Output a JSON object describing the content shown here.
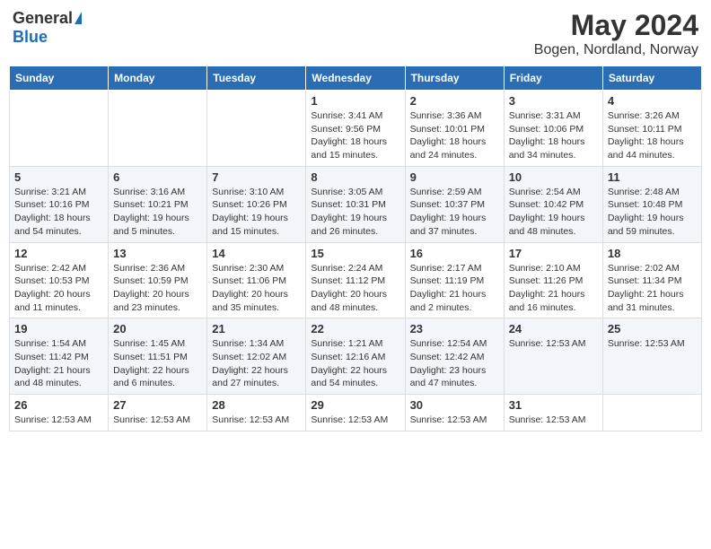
{
  "header": {
    "logo_general": "General",
    "logo_blue": "Blue",
    "title": "May 2024",
    "subtitle": "Bogen, Nordland, Norway"
  },
  "calendar": {
    "headers": [
      "Sunday",
      "Monday",
      "Tuesday",
      "Wednesday",
      "Thursday",
      "Friday",
      "Saturday"
    ],
    "rows": [
      [
        {
          "day": "",
          "info": ""
        },
        {
          "day": "",
          "info": ""
        },
        {
          "day": "",
          "info": ""
        },
        {
          "day": "1",
          "info": "Sunrise: 3:41 AM\nSunset: 9:56 PM\nDaylight: 18 hours and 15 minutes."
        },
        {
          "day": "2",
          "info": "Sunrise: 3:36 AM\nSunset: 10:01 PM\nDaylight: 18 hours and 24 minutes."
        },
        {
          "day": "3",
          "info": "Sunrise: 3:31 AM\nSunset: 10:06 PM\nDaylight: 18 hours and 34 minutes."
        },
        {
          "day": "4",
          "info": "Sunrise: 3:26 AM\nSunset: 10:11 PM\nDaylight: 18 hours and 44 minutes."
        }
      ],
      [
        {
          "day": "5",
          "info": "Sunrise: 3:21 AM\nSunset: 10:16 PM\nDaylight: 18 hours and 54 minutes."
        },
        {
          "day": "6",
          "info": "Sunrise: 3:16 AM\nSunset: 10:21 PM\nDaylight: 19 hours and 5 minutes."
        },
        {
          "day": "7",
          "info": "Sunrise: 3:10 AM\nSunset: 10:26 PM\nDaylight: 19 hours and 15 minutes."
        },
        {
          "day": "8",
          "info": "Sunrise: 3:05 AM\nSunset: 10:31 PM\nDaylight: 19 hours and 26 minutes."
        },
        {
          "day": "9",
          "info": "Sunrise: 2:59 AM\nSunset: 10:37 PM\nDaylight: 19 hours and 37 minutes."
        },
        {
          "day": "10",
          "info": "Sunrise: 2:54 AM\nSunset: 10:42 PM\nDaylight: 19 hours and 48 minutes."
        },
        {
          "day": "11",
          "info": "Sunrise: 2:48 AM\nSunset: 10:48 PM\nDaylight: 19 hours and 59 minutes."
        }
      ],
      [
        {
          "day": "12",
          "info": "Sunrise: 2:42 AM\nSunset: 10:53 PM\nDaylight: 20 hours and 11 minutes."
        },
        {
          "day": "13",
          "info": "Sunrise: 2:36 AM\nSunset: 10:59 PM\nDaylight: 20 hours and 23 minutes."
        },
        {
          "day": "14",
          "info": "Sunrise: 2:30 AM\nSunset: 11:06 PM\nDaylight: 20 hours and 35 minutes."
        },
        {
          "day": "15",
          "info": "Sunrise: 2:24 AM\nSunset: 11:12 PM\nDaylight: 20 hours and 48 minutes."
        },
        {
          "day": "16",
          "info": "Sunrise: 2:17 AM\nSunset: 11:19 PM\nDaylight: 21 hours and 2 minutes."
        },
        {
          "day": "17",
          "info": "Sunrise: 2:10 AM\nSunset: 11:26 PM\nDaylight: 21 hours and 16 minutes."
        },
        {
          "day": "18",
          "info": "Sunrise: 2:02 AM\nSunset: 11:34 PM\nDaylight: 21 hours and 31 minutes."
        }
      ],
      [
        {
          "day": "19",
          "info": "Sunrise: 1:54 AM\nSunset: 11:42 PM\nDaylight: 21 hours and 48 minutes."
        },
        {
          "day": "20",
          "info": "Sunrise: 1:45 AM\nSunset: 11:51 PM\nDaylight: 22 hours and 6 minutes."
        },
        {
          "day": "21",
          "info": "Sunrise: 1:34 AM\nSunset: 12:02 AM\nDaylight: 22 hours and 27 minutes."
        },
        {
          "day": "22",
          "info": "Sunrise: 1:21 AM\nSunset: 12:16 AM\nDaylight: 22 hours and 54 minutes."
        },
        {
          "day": "23",
          "info": "Sunrise: 12:54 AM\nSunset: 12:42 AM\nDaylight: 23 hours and 47 minutes."
        },
        {
          "day": "24",
          "info": "Sunrise: 12:53 AM"
        },
        {
          "day": "25",
          "info": "Sunrise: 12:53 AM"
        }
      ],
      [
        {
          "day": "26",
          "info": "Sunrise: 12:53 AM"
        },
        {
          "day": "27",
          "info": "Sunrise: 12:53 AM"
        },
        {
          "day": "28",
          "info": "Sunrise: 12:53 AM"
        },
        {
          "day": "29",
          "info": "Sunrise: 12:53 AM"
        },
        {
          "day": "30",
          "info": "Sunrise: 12:53 AM"
        },
        {
          "day": "31",
          "info": "Sunrise: 12:53 AM"
        },
        {
          "day": "",
          "info": ""
        }
      ]
    ]
  }
}
